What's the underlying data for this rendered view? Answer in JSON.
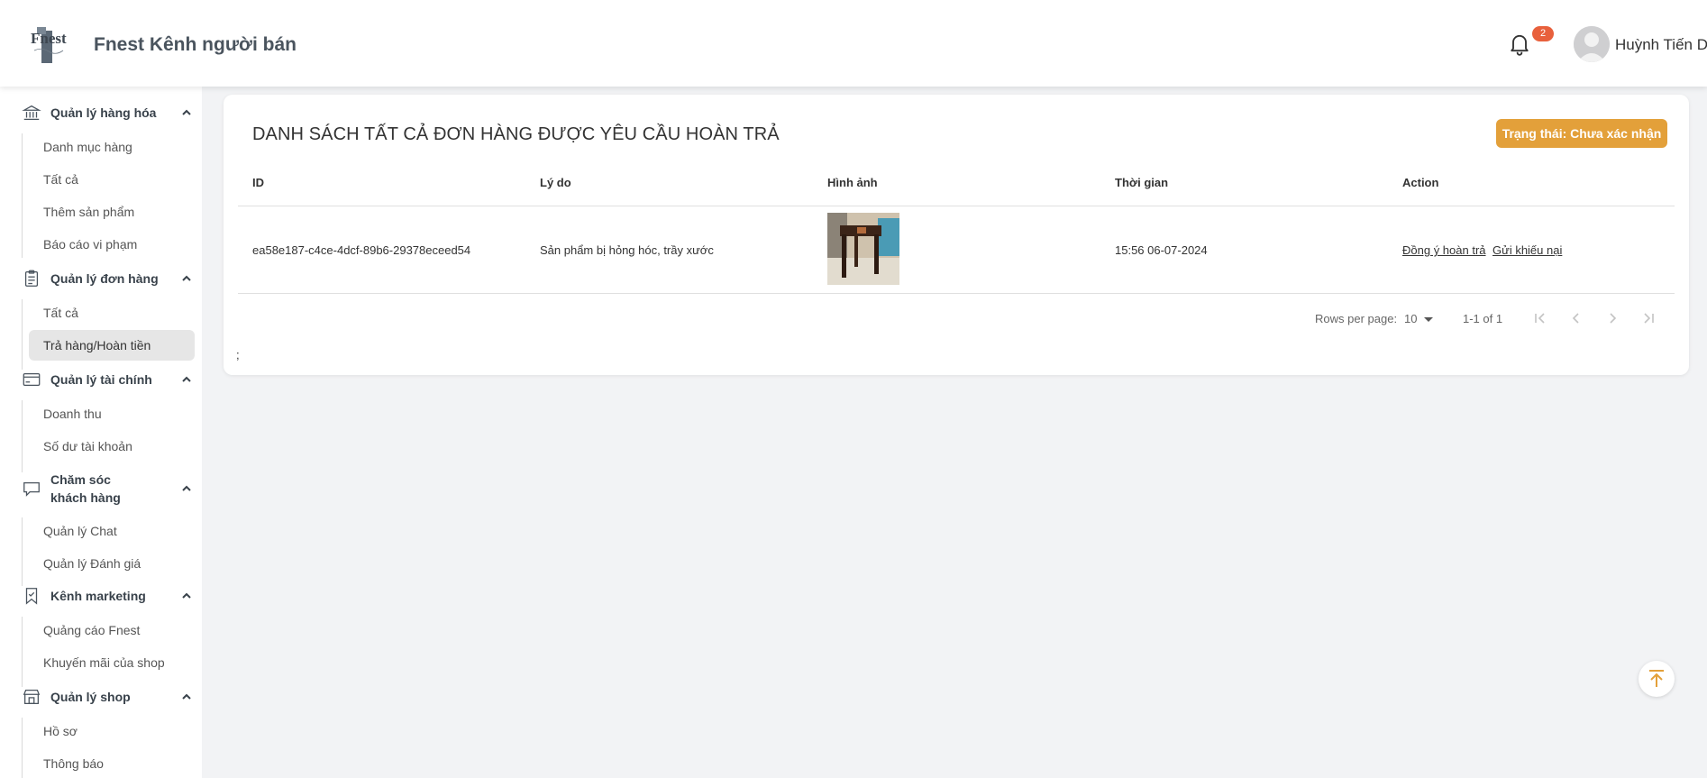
{
  "header": {
    "brand": "Fnest Kênh người bán",
    "notification_count": "2",
    "user_name": "Huỳnh Tiến Dĩ",
    "logo_text": "Fnest"
  },
  "sidebar": {
    "sections": [
      {
        "title": "Quản lý hàng hóa",
        "icon": "bank-icon",
        "items": [
          "Danh mục hàng",
          "Tất cả",
          "Thêm sản phẩm",
          "Báo cáo vi phạm"
        ]
      },
      {
        "title": "Quản lý đơn hàng",
        "icon": "clipboard-icon",
        "items": [
          "Tất cả",
          "Trả hàng/Hoàn tiền"
        ]
      },
      {
        "title": "Quản lý tài chính",
        "icon": "credit-card-icon",
        "items": [
          "Doanh thu",
          "Số dư tài khoản"
        ]
      },
      {
        "title_line1": "Chăm sóc",
        "title_line2": "khách hàng",
        "icon": "chat-bubble-icon",
        "items": [
          "Quản lý Chat",
          "Quản lý Đánh giá"
        ]
      },
      {
        "title": "Kênh marketing",
        "icon": "bookmark-icon",
        "items": [
          "Quảng cáo Fnest",
          "Khuyến mãi của shop"
        ]
      },
      {
        "title": "Quản lý shop",
        "icon": "store-icon",
        "items": [
          "Hồ sơ",
          "Thông báo"
        ]
      }
    ],
    "active_item": "Trả hàng/Hoàn tiền"
  },
  "main": {
    "title": "DANH SÁCH TẤT CẢ ĐƠN HÀNG ĐƯỢC YÊU CẦU HOÀN TRẢ",
    "status_button": "Trạng thái: Chưa xác nhận",
    "colors": {
      "accent": "#e3a03a",
      "badge": "#e8603c"
    },
    "table": {
      "columns": [
        "ID",
        "Lý do",
        "Hình ảnh",
        "Thời gian",
        "Action"
      ],
      "rows": [
        {
          "id": "ea58e187-c4ce-4dcf-89b6-29378eceed54",
          "reason": "Sản phẩm bị hỏng hóc, trầy xước",
          "image": "wooden-table-photo",
          "time": "15:56 06-07-2024",
          "action_accept": "Đồng ý hoàn trả",
          "action_complaint": "Gửi khiếu nại"
        }
      ]
    },
    "pagination": {
      "rows_per_page_label": "Rows per page:",
      "rows_per_page": "10",
      "range": "1-1 of 1"
    },
    "footnote": ";"
  }
}
